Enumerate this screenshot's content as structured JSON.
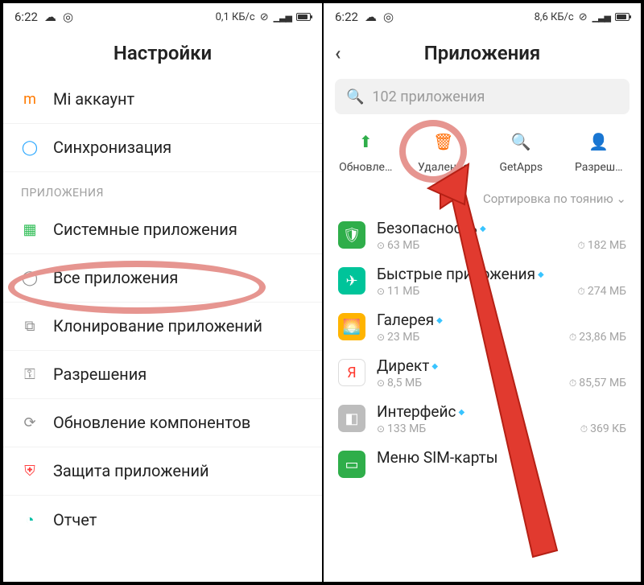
{
  "left": {
    "status": {
      "time": "6:22",
      "net": "0,1 КБ/с"
    },
    "title": "Настройки",
    "rows": [
      {
        "icon": "mi",
        "label": "Mi аккаунт"
      },
      {
        "icon": "sync",
        "label": "Синхронизация"
      }
    ],
    "section": "ПРИЛОЖЕНИЯ",
    "app_rows": [
      {
        "icon": "grid",
        "label": "Системные приложения"
      },
      {
        "icon": "circle",
        "label": "Все приложения"
      },
      {
        "icon": "clone",
        "label": "Клонирование приложений"
      },
      {
        "icon": "perm",
        "label": "Разрешения"
      },
      {
        "icon": "update",
        "label": "Обновление компонентов"
      },
      {
        "icon": "shield",
        "label": "Защита приложений"
      },
      {
        "icon": "report",
        "label": "Отчет"
      }
    ]
  },
  "right": {
    "status": {
      "time": "6:22",
      "net": "8,6 КБ/с"
    },
    "title": "Приложения",
    "search_placeholder": "102 приложения",
    "shortcuts": [
      {
        "label": "Обновле…",
        "color": "a-green",
        "glyph": "↑"
      },
      {
        "label": "Удаление",
        "color": "a-orange",
        "glyph": "🗑"
      },
      {
        "label": "GetApps",
        "color": "a-yellow",
        "glyph": "🔍"
      },
      {
        "label": "Разреш…",
        "color": "a-cyan",
        "glyph": "👤"
      }
    ],
    "sort": "Сортировка по      тоянию",
    "apps": [
      {
        "name": "Безопасность",
        "size": "63 МБ",
        "time": "182 МБ",
        "iconColor": "a-green",
        "glyph": "🛡"
      },
      {
        "name": "Быстрые приложения",
        "size": "11 МБ",
        "time": "274 МБ",
        "iconColor": "a-teal",
        "glyph": "✈"
      },
      {
        "name": "Галерея",
        "size": "23 МБ",
        "time": "23,86 МБ",
        "iconColor": "a-yellow",
        "glyph": "🌅"
      },
      {
        "name": "Директ",
        "size": "8,5 МБ",
        "time": "85,57 МБ",
        "iconColor": "a-blue",
        "glyph": "Я"
      },
      {
        "name": "Интерфейс",
        "size": "133 МБ",
        "time": "369 КБ",
        "iconColor": "a-gray",
        "glyph": "◧"
      },
      {
        "name": "Меню SIM-карты",
        "size": "",
        "time": "",
        "iconColor": "a-green",
        "glyph": "▭"
      }
    ]
  }
}
